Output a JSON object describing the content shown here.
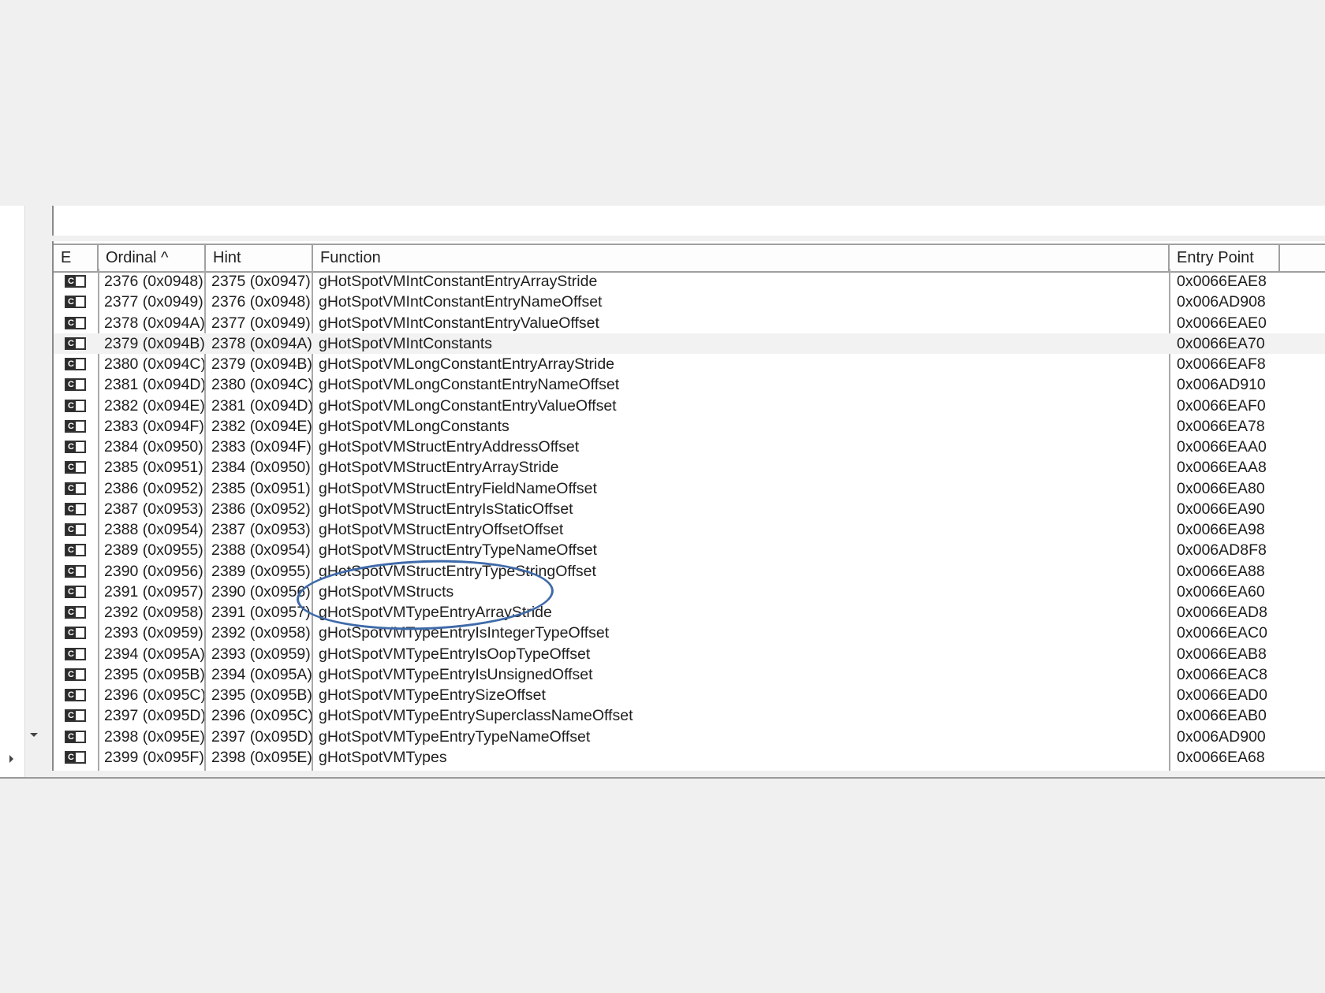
{
  "columns": {
    "e": "E",
    "ordinal": "Ordinal ^",
    "hint": "Hint",
    "function": "Function",
    "entry_point": "Entry Point"
  },
  "icon_letter": "C",
  "rows": [
    {
      "ordinal": "2376 (0x0948)",
      "hint": "2375 (0x0947)",
      "function": "gHotSpotVMIntConstantEntryArrayStride",
      "entry_point": "0x0066EAE8"
    },
    {
      "ordinal": "2377 (0x0949)",
      "hint": "2376 (0x0948)",
      "function": "gHotSpotVMIntConstantEntryNameOffset",
      "entry_point": "0x006AD908"
    },
    {
      "ordinal": "2378 (0x094A)",
      "hint": "2377 (0x0949)",
      "function": "gHotSpotVMIntConstantEntryValueOffset",
      "entry_point": "0x0066EAE0"
    },
    {
      "ordinal": "2379 (0x094B)",
      "hint": "2378 (0x094A)",
      "function": "gHotSpotVMIntConstants",
      "entry_point": "0x0066EA70"
    },
    {
      "ordinal": "2380 (0x094C)",
      "hint": "2379 (0x094B)",
      "function": "gHotSpotVMLongConstantEntryArrayStride",
      "entry_point": "0x0066EAF8"
    },
    {
      "ordinal": "2381 (0x094D)",
      "hint": "2380 (0x094C)",
      "function": "gHotSpotVMLongConstantEntryNameOffset",
      "entry_point": "0x006AD910"
    },
    {
      "ordinal": "2382 (0x094E)",
      "hint": "2381 (0x094D)",
      "function": "gHotSpotVMLongConstantEntryValueOffset",
      "entry_point": "0x0066EAF0"
    },
    {
      "ordinal": "2383 (0x094F)",
      "hint": "2382 (0x094E)",
      "function": "gHotSpotVMLongConstants",
      "entry_point": "0x0066EA78"
    },
    {
      "ordinal": "2384 (0x0950)",
      "hint": "2383 (0x094F)",
      "function": "gHotSpotVMStructEntryAddressOffset",
      "entry_point": "0x0066EAA0"
    },
    {
      "ordinal": "2385 (0x0951)",
      "hint": "2384 (0x0950)",
      "function": "gHotSpotVMStructEntryArrayStride",
      "entry_point": "0x0066EAA8"
    },
    {
      "ordinal": "2386 (0x0952)",
      "hint": "2385 (0x0951)",
      "function": "gHotSpotVMStructEntryFieldNameOffset",
      "entry_point": "0x0066EA80"
    },
    {
      "ordinal": "2387 (0x0953)",
      "hint": "2386 (0x0952)",
      "function": "gHotSpotVMStructEntryIsStaticOffset",
      "entry_point": "0x0066EA90"
    },
    {
      "ordinal": "2388 (0x0954)",
      "hint": "2387 (0x0953)",
      "function": "gHotSpotVMStructEntryOffsetOffset",
      "entry_point": "0x0066EA98"
    },
    {
      "ordinal": "2389 (0x0955)",
      "hint": "2388 (0x0954)",
      "function": "gHotSpotVMStructEntryTypeNameOffset",
      "entry_point": "0x006AD8F8"
    },
    {
      "ordinal": "2390 (0x0956)",
      "hint": "2389 (0x0955)",
      "function": "gHotSpotVMStructEntryTypeStringOffset",
      "entry_point": "0x0066EA88"
    },
    {
      "ordinal": "2391 (0x0957)",
      "hint": "2390 (0x0956)",
      "function": "gHotSpotVMStructs",
      "entry_point": "0x0066EA60"
    },
    {
      "ordinal": "2392 (0x0958)",
      "hint": "2391 (0x0957)",
      "function": "gHotSpotVMTypeEntryArrayStride",
      "entry_point": "0x0066EAD8"
    },
    {
      "ordinal": "2393 (0x0959)",
      "hint": "2392 (0x0958)",
      "function": "gHotSpotVMTypeEntryIsIntegerTypeOffset",
      "entry_point": "0x0066EAC0"
    },
    {
      "ordinal": "2394 (0x095A)",
      "hint": "2393 (0x0959)",
      "function": "gHotSpotVMTypeEntryIsOopTypeOffset",
      "entry_point": "0x0066EAB8"
    },
    {
      "ordinal": "2395 (0x095B)",
      "hint": "2394 (0x095A)",
      "function": "gHotSpotVMTypeEntryIsUnsignedOffset",
      "entry_point": "0x0066EAC8"
    },
    {
      "ordinal": "2396 (0x095C)",
      "hint": "2395 (0x095B)",
      "function": "gHotSpotVMTypeEntrySizeOffset",
      "entry_point": "0x0066EAD0"
    },
    {
      "ordinal": "2397 (0x095D)",
      "hint": "2396 (0x095C)",
      "function": "gHotSpotVMTypeEntrySuperclassNameOffset",
      "entry_point": "0x0066EAB0"
    },
    {
      "ordinal": "2398 (0x095E)",
      "hint": "2397 (0x095D)",
      "function": "gHotSpotVMTypeEntryTypeNameOffset",
      "entry_point": "0x006AD900"
    },
    {
      "ordinal": "2399 (0x095F)",
      "hint": "2398 (0x095E)",
      "function": "gHotSpotVMTypes",
      "entry_point": "0x0066EA68"
    }
  ],
  "highlighted_row_index": 3,
  "annotation_color": "#3f6aa9"
}
